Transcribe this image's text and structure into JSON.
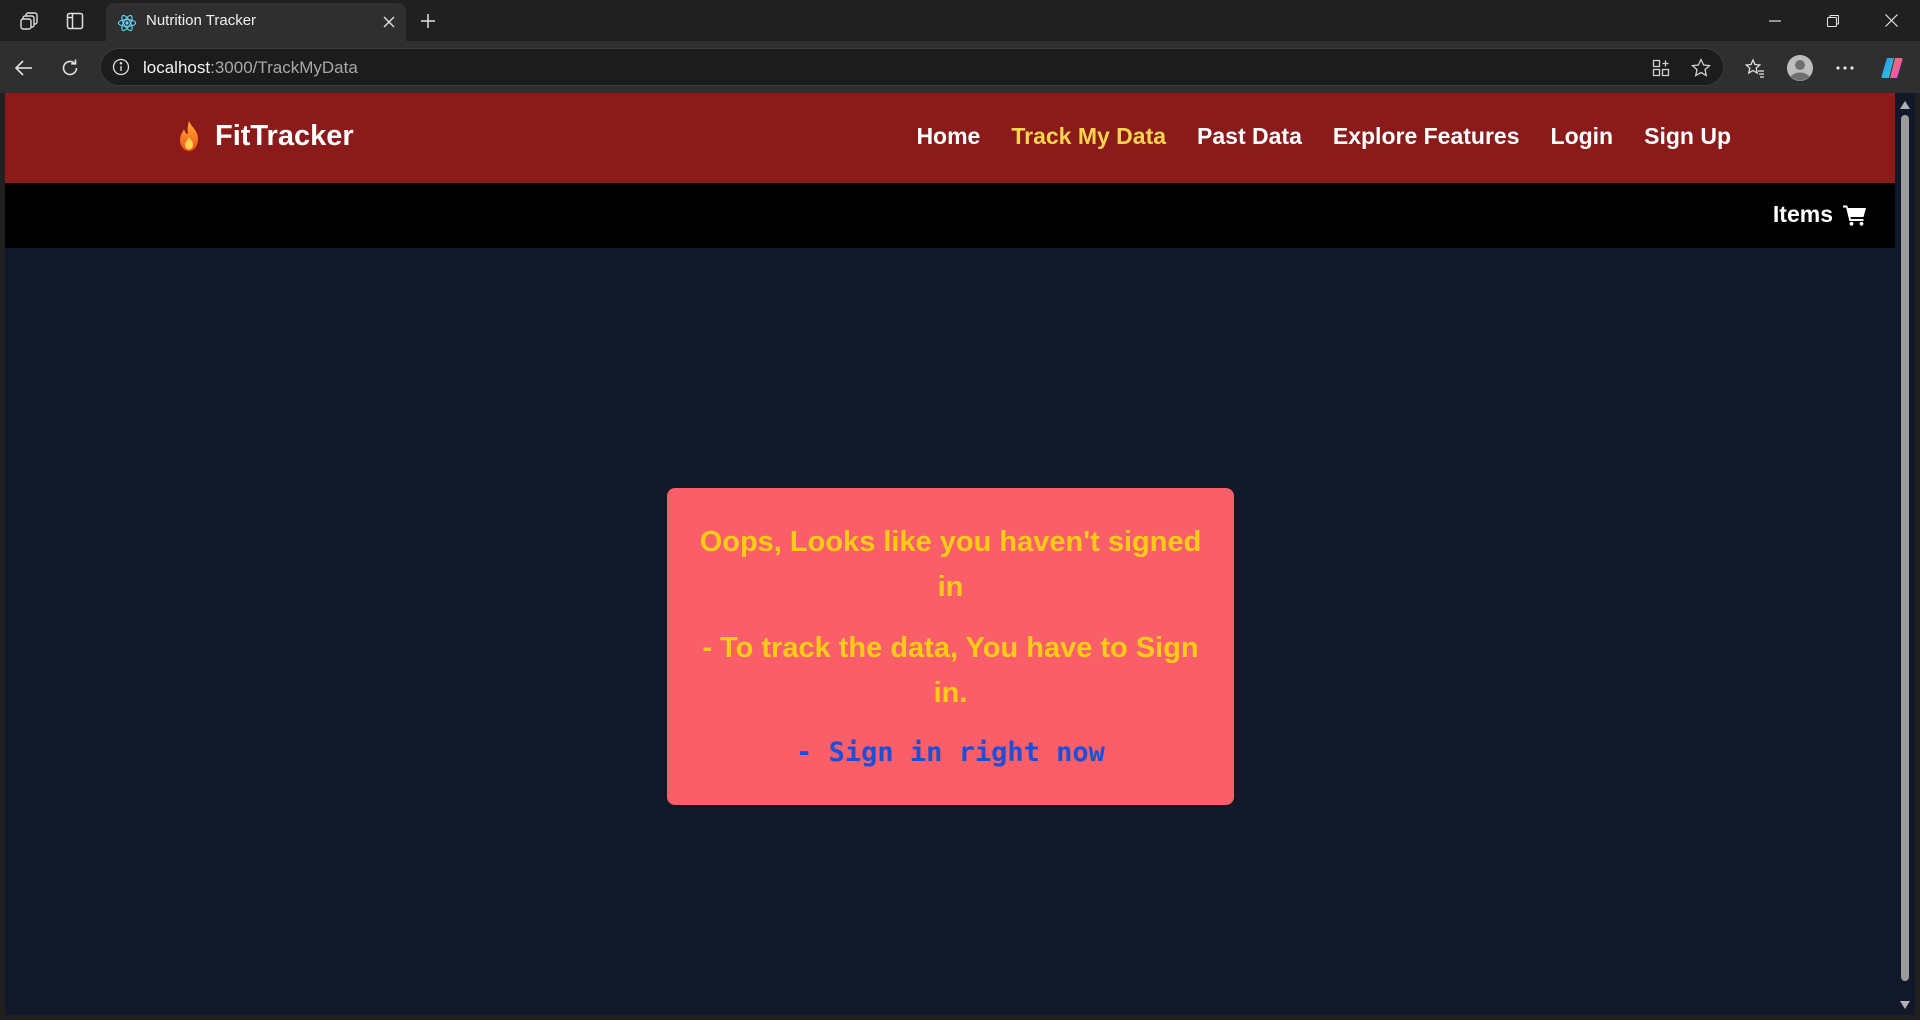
{
  "browser": {
    "tab_title": "Nutrition Tracker",
    "url_host": "localhost",
    "url_rest": ":3000/TrackMyData"
  },
  "site": {
    "brand": "FitTracker",
    "nav": [
      {
        "label": "Home",
        "active": false
      },
      {
        "label": "Track My Data",
        "active": true
      },
      {
        "label": "Past Data",
        "active": false
      },
      {
        "label": "Explore Features",
        "active": false
      },
      {
        "label": "Login",
        "active": false
      },
      {
        "label": "Sign Up",
        "active": false
      }
    ],
    "items_label": "Items"
  },
  "alert": {
    "heading": "Oops, Looks like you haven't signed in",
    "message": "- To track the data, You have to Sign in.",
    "link": "- Sign in right now"
  },
  "colors": {
    "navbar": "#8b1a1a",
    "active_link": "#fcd34d",
    "page_bg": "#111827",
    "alert_bg": "#fa5f69",
    "alert_text": "#facc15",
    "alert_link": "#1d4ed8"
  },
  "icons": {
    "brand": "flame-icon",
    "items": "cart-icon"
  }
}
